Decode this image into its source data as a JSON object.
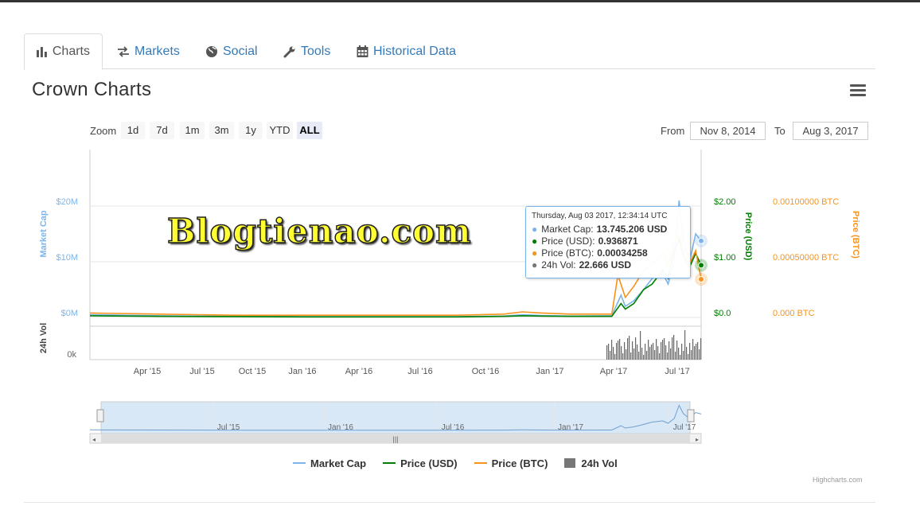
{
  "tabs": [
    {
      "label": "Charts",
      "icon": "bar-chart-icon"
    },
    {
      "label": "Markets",
      "icon": "exchange-icon"
    },
    {
      "label": "Social",
      "icon": "globe-icon"
    },
    {
      "label": "Tools",
      "icon": "wrench-icon"
    },
    {
      "label": "Historical Data",
      "icon": "calendar-icon"
    }
  ],
  "page_title": "Crown Charts",
  "zoom": {
    "label": "Zoom",
    "buttons": [
      "1d",
      "7d",
      "1m",
      "3m",
      "1y",
      "YTD",
      "ALL"
    ],
    "selected": "ALL"
  },
  "range": {
    "from_label": "From",
    "from": "Nov 8, 2014",
    "to_label": "To",
    "to": "Aug 3, 2017"
  },
  "watermark": "Blogtienao.com",
  "tooltip": {
    "header": "Thursday, Aug 03 2017, 12:34:14 UTC",
    "rows": [
      {
        "label": "Market Cap:",
        "value": "13.745.206 USD",
        "color": "#7cb5ec"
      },
      {
        "label": "Price (USD):",
        "value": "0.936871",
        "color": "#008000"
      },
      {
        "label": "Price (BTC):",
        "value": "0.00034258",
        "color": "#f7931a"
      },
      {
        "label": "24h Vol:",
        "value": "22.666 USD",
        "color": "#777777"
      }
    ]
  },
  "legend": [
    {
      "label": "Market Cap",
      "color": "#7cb5ec",
      "shape": "line"
    },
    {
      "label": "Price (USD)",
      "color": "#008000",
      "shape": "line"
    },
    {
      "label": "Price (BTC)",
      "color": "#f7931a",
      "shape": "line"
    },
    {
      "label": "24h Vol",
      "color": "#777777",
      "shape": "square"
    }
  ],
  "credits": "Highcharts.com",
  "navigator_labels": [
    "Jul '15",
    "Jan '16",
    "Jul '16",
    "Jan '17",
    "Jul '17"
  ],
  "chart_data": {
    "type": "line",
    "x_range": [
      "2014-11-08",
      "2017-08-03"
    ],
    "x_ticks": [
      "Apr '15",
      "Jul '15",
      "Oct '15",
      "Jan '16",
      "Apr '16",
      "Jul '16",
      "Oct '16",
      "Jan '17",
      "Apr '17",
      "Jul '17"
    ],
    "axes": {
      "market_cap": {
        "label": "Market Cap",
        "ticks": [
          "$0M",
          "$10M",
          "$20M"
        ],
        "range": [
          0,
          20000000
        ],
        "color": "#7cb5ec"
      },
      "price_usd": {
        "label": "Price (USD)",
        "ticks": [
          "$0.0",
          "$1.00",
          "$2.00"
        ],
        "range": [
          0,
          2
        ],
        "color": "#008000"
      },
      "price_btc": {
        "label": "Price (BTC)",
        "ticks": [
          "0.000 BTC",
          "0.00050000 BTC",
          "0.00100000 BTC"
        ],
        "range": [
          0,
          0.001
        ],
        "color": "#f7931a"
      },
      "volume": {
        "label": "24h Vol",
        "ticks": [
          "0k"
        ],
        "color": "#777777"
      }
    },
    "grid": true,
    "series": [
      {
        "name": "Market Cap",
        "axis": "market_cap",
        "points": [
          [
            "2014-11-08",
            500000
          ],
          [
            "2015-03-01",
            300000
          ],
          [
            "2015-07-01",
            200000
          ],
          [
            "2015-11-01",
            150000
          ],
          [
            "2016-03-01",
            150000
          ],
          [
            "2016-07-01",
            150000
          ],
          [
            "2016-09-15",
            250000
          ],
          [
            "2016-10-15",
            500000
          ],
          [
            "2016-11-15",
            350000
          ],
          [
            "2017-01-01",
            250000
          ],
          [
            "2017-03-10",
            300000
          ],
          [
            "2017-03-25",
            4000000
          ],
          [
            "2017-04-01",
            2000000
          ],
          [
            "2017-04-15",
            3000000
          ],
          [
            "2017-05-01",
            5000000
          ],
          [
            "2017-05-15",
            7000000
          ],
          [
            "2017-06-01",
            8000000
          ],
          [
            "2017-06-10",
            6000000
          ],
          [
            "2017-06-20",
            10000000
          ],
          [
            "2017-06-28",
            21000000
          ],
          [
            "2017-07-05",
            14000000
          ],
          [
            "2017-07-15",
            10000000
          ],
          [
            "2017-07-25",
            15000000
          ],
          [
            "2017-08-03",
            13745206
          ]
        ]
      },
      {
        "name": "Price (USD)",
        "axis": "price_usd",
        "points": [
          [
            "2014-11-08",
            0.03
          ],
          [
            "2015-03-01",
            0.02
          ],
          [
            "2015-07-01",
            0.015
          ],
          [
            "2015-11-01",
            0.01
          ],
          [
            "2016-03-01",
            0.01
          ],
          [
            "2016-07-01",
            0.01
          ],
          [
            "2016-09-15",
            0.02
          ],
          [
            "2016-10-15",
            0.03
          ],
          [
            "2016-11-15",
            0.025
          ],
          [
            "2017-01-01",
            0.02
          ],
          [
            "2017-03-10",
            0.02
          ],
          [
            "2017-03-25",
            0.25
          ],
          [
            "2017-04-01",
            0.15
          ],
          [
            "2017-04-15",
            0.25
          ],
          [
            "2017-05-01",
            0.5
          ],
          [
            "2017-05-15",
            0.6
          ],
          [
            "2017-06-01",
            0.85
          ],
          [
            "2017-06-10",
            0.7
          ],
          [
            "2017-06-20",
            1.2
          ],
          [
            "2017-06-28",
            1.4
          ],
          [
            "2017-07-05",
            1.1
          ],
          [
            "2017-07-15",
            0.9
          ],
          [
            "2017-07-25",
            1.15
          ],
          [
            "2017-08-03",
            0.936871
          ]
        ]
      },
      {
        "name": "Price (BTC)",
        "axis": "price_btc",
        "points": [
          [
            "2014-11-08",
            4e-05
          ],
          [
            "2015-03-01",
            3e-05
          ],
          [
            "2015-07-01",
            2e-05
          ],
          [
            "2015-11-01",
            2e-05
          ],
          [
            "2016-03-01",
            2e-05
          ],
          [
            "2016-07-01",
            2e-05
          ],
          [
            "2016-09-15",
            3e-05
          ],
          [
            "2016-10-15",
            5e-05
          ],
          [
            "2016-11-15",
            4e-05
          ],
          [
            "2017-01-01",
            3e-05
          ],
          [
            "2017-03-10",
            3e-05
          ],
          [
            "2017-03-20",
            0.00038
          ],
          [
            "2017-04-01",
            0.00018
          ],
          [
            "2017-04-15",
            0.00028
          ],
          [
            "2017-05-01",
            0.00042
          ],
          [
            "2017-05-15",
            0.00048
          ],
          [
            "2017-06-01",
            0.00058
          ],
          [
            "2017-06-10",
            0.00046
          ],
          [
            "2017-06-20",
            0.00068
          ],
          [
            "2017-06-28",
            0.00074
          ],
          [
            "2017-07-05",
            0.00062
          ],
          [
            "2017-07-15",
            0.00048
          ],
          [
            "2017-07-25",
            0.0006
          ],
          [
            "2017-08-03",
            0.00034258
          ]
        ]
      }
    ]
  }
}
